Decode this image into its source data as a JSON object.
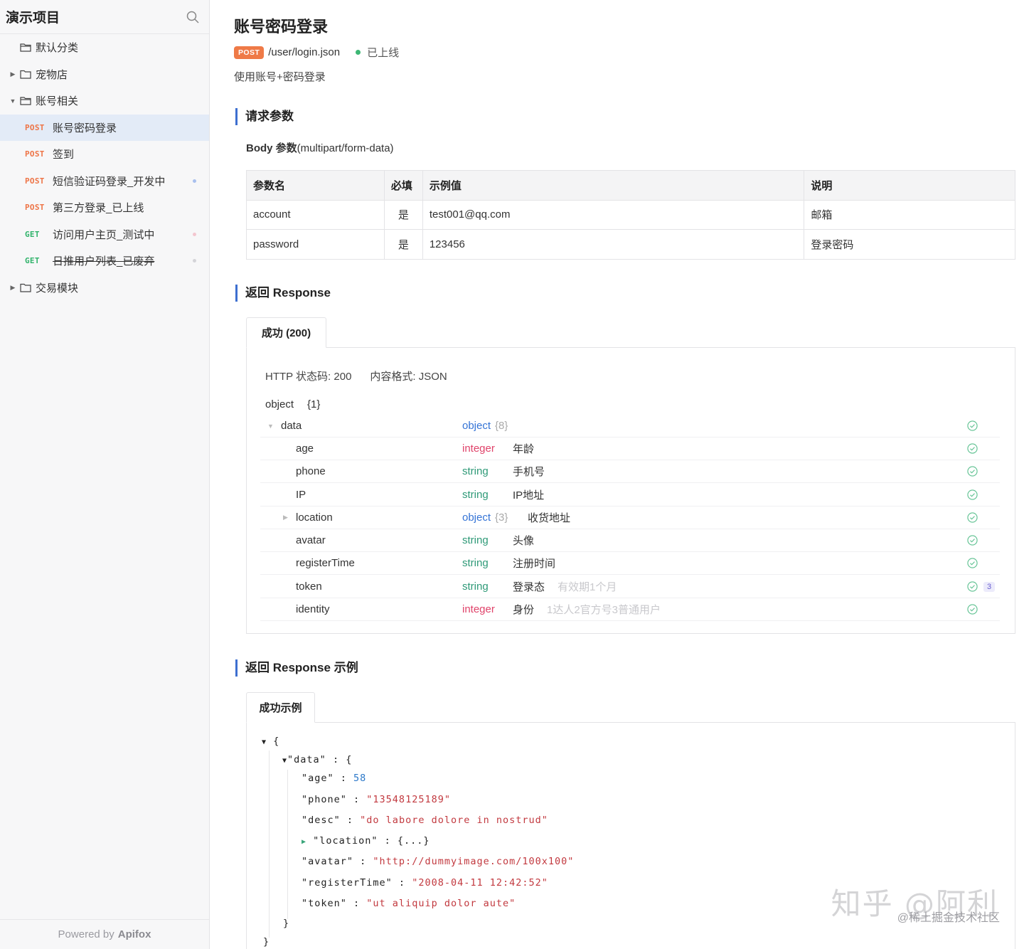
{
  "sidebar": {
    "project_title": "演示项目",
    "search_icon": "search-icon",
    "items": [
      {
        "type": "folder",
        "label": "默认分类",
        "expanded": false,
        "caret": ""
      },
      {
        "type": "folder",
        "label": "宠物店",
        "expanded": false,
        "caret": "▶"
      },
      {
        "type": "folder",
        "label": "账号相关",
        "expanded": true,
        "caret": "▼"
      },
      {
        "type": "api",
        "method": "POST",
        "label": "账号密码登录",
        "active": true
      },
      {
        "type": "api",
        "method": "POST",
        "label": "签到"
      },
      {
        "type": "api",
        "method": "POST",
        "label": "短信验证码登录_开发中",
        "dot_color": "#a9c0ee"
      },
      {
        "type": "api",
        "method": "POST",
        "label": "第三方登录_已上线"
      },
      {
        "type": "api",
        "method": "GET",
        "label": "访问用户主页_测试中",
        "dot_color": "#f3c6cf"
      },
      {
        "type": "api",
        "method": "GET",
        "label": "日推用户列表_已废弃",
        "dot_color": "#d4d4d8",
        "deprecated": true
      },
      {
        "type": "folder",
        "label": "交易模块",
        "expanded": false,
        "caret": "▶"
      }
    ],
    "footer_prefix": "Powered by",
    "footer_brand": "Apifox"
  },
  "page": {
    "title": "账号密码登录",
    "method": "POST",
    "path": "/user/login.json",
    "status": "已上线",
    "description": "使用账号+密码登录"
  },
  "request": {
    "section_title": "请求参数",
    "body_label_bold": "Body 参数",
    "body_label_type": "(multipart/form-data)",
    "columns": [
      "参数名",
      "必填",
      "示例值",
      "说明"
    ],
    "rows": [
      [
        "account",
        "是",
        "test001@qq.com",
        "邮箱"
      ],
      [
        "password",
        "是",
        "123456",
        "登录密码"
      ]
    ]
  },
  "response": {
    "section_title": "返回 Response",
    "tab_label": "成功 (200)",
    "http_status": "HTTP 状态码: 200",
    "content_type": "内容格式: JSON",
    "root_type": "object",
    "root_count": "{1}",
    "fields": [
      {
        "name": "data",
        "type": "object",
        "count": "{8}",
        "desc": "",
        "note": ""
      },
      {
        "name": "age",
        "type": "integer",
        "count": "",
        "desc": "年龄",
        "note": ""
      },
      {
        "name": "phone",
        "type": "string",
        "count": "",
        "desc": "手机号",
        "note": ""
      },
      {
        "name": "IP",
        "type": "string",
        "count": "",
        "desc": "IP地址",
        "note": ""
      },
      {
        "name": "location",
        "type": "object",
        "count": "{3}",
        "desc": "收货地址",
        "note": ""
      },
      {
        "name": "avatar",
        "type": "string",
        "count": "",
        "desc": "头像",
        "note": ""
      },
      {
        "name": "registerTime",
        "type": "string",
        "count": "",
        "desc": "注册时间",
        "note": ""
      },
      {
        "name": "token",
        "type": "string",
        "count": "",
        "desc": "登录态",
        "note": "有效期1个月",
        "badge": "3"
      },
      {
        "name": "identity",
        "type": "integer",
        "count": "",
        "desc": "身份",
        "note": "1达人2官方号3普通用户"
      }
    ]
  },
  "example": {
    "section_title": "返回 Response 示例",
    "tab_label": "成功示例",
    "lines": {
      "open": "{",
      "data_key": "\"data\"",
      "age_key": "\"age\"",
      "age_val": "58",
      "phone_key": "\"phone\"",
      "phone_val": "\"13548125189\"",
      "desc_key": "\"desc\"",
      "desc_val": "\"do labore dolore in nostrud\"",
      "location_key": "\"location\"",
      "location_val": "{...}",
      "avatar_key": "\"avatar\"",
      "avatar_val": "\"http://dummyimage.com/100x100\"",
      "regtime_key": "\"registerTime\"",
      "regtime_val": "\"2008-04-11 12:42:52\"",
      "token_key": "\"token\"",
      "token_val": "\"ut aliquip dolor aute\"",
      "inner_close": "}",
      "outer_close": "}"
    }
  },
  "watermark": {
    "big": "知乎 @阿利",
    "small": "@稀土掘金技术社区"
  },
  "colors": {
    "accent": "#3d6fd0",
    "post": "#ee7446",
    "get": "#31b36b",
    "online": "#3db774"
  }
}
